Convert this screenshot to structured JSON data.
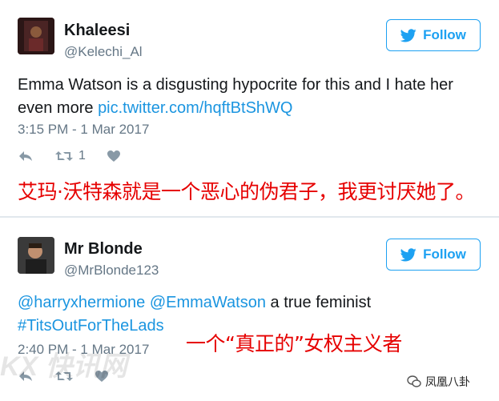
{
  "tweets": [
    {
      "display_name": "Khaleesi",
      "handle": "@Kelechi_Al",
      "follow_label": "Follow",
      "text": "Emma Watson is a disgusting hypocrite for this and I hate her even more ",
      "link": "pic.twitter.com/hqftBtShWQ",
      "timestamp": "3:15 PM - 1 Mar 2017",
      "retweet_count": "1",
      "caption": "艾玛·沃特森就是一个恶心的伪君子，我更讨厌她了。"
    },
    {
      "display_name": "Mr Blonde",
      "handle": "@MrBlonde123",
      "follow_label": "Follow",
      "mention1": "@harryxhermione",
      "mention2": "@EmmaWatson",
      "text_after": " a true feminist",
      "hashtag": "#TitsOutForTheLads",
      "timestamp": "2:40 PM - 1 Mar 2017",
      "caption": "一个“真正的”女权主义者"
    }
  ],
  "watermark": {
    "left": "KX 快讯网",
    "right": "凤凰八卦"
  },
  "colors": {
    "accent": "#1da1f2",
    "caption": "#e60000",
    "muted": "#657786"
  },
  "icons": [
    "twitter-bird-icon",
    "reply-icon",
    "retweet-icon",
    "like-icon",
    "wechat-icon"
  ]
}
